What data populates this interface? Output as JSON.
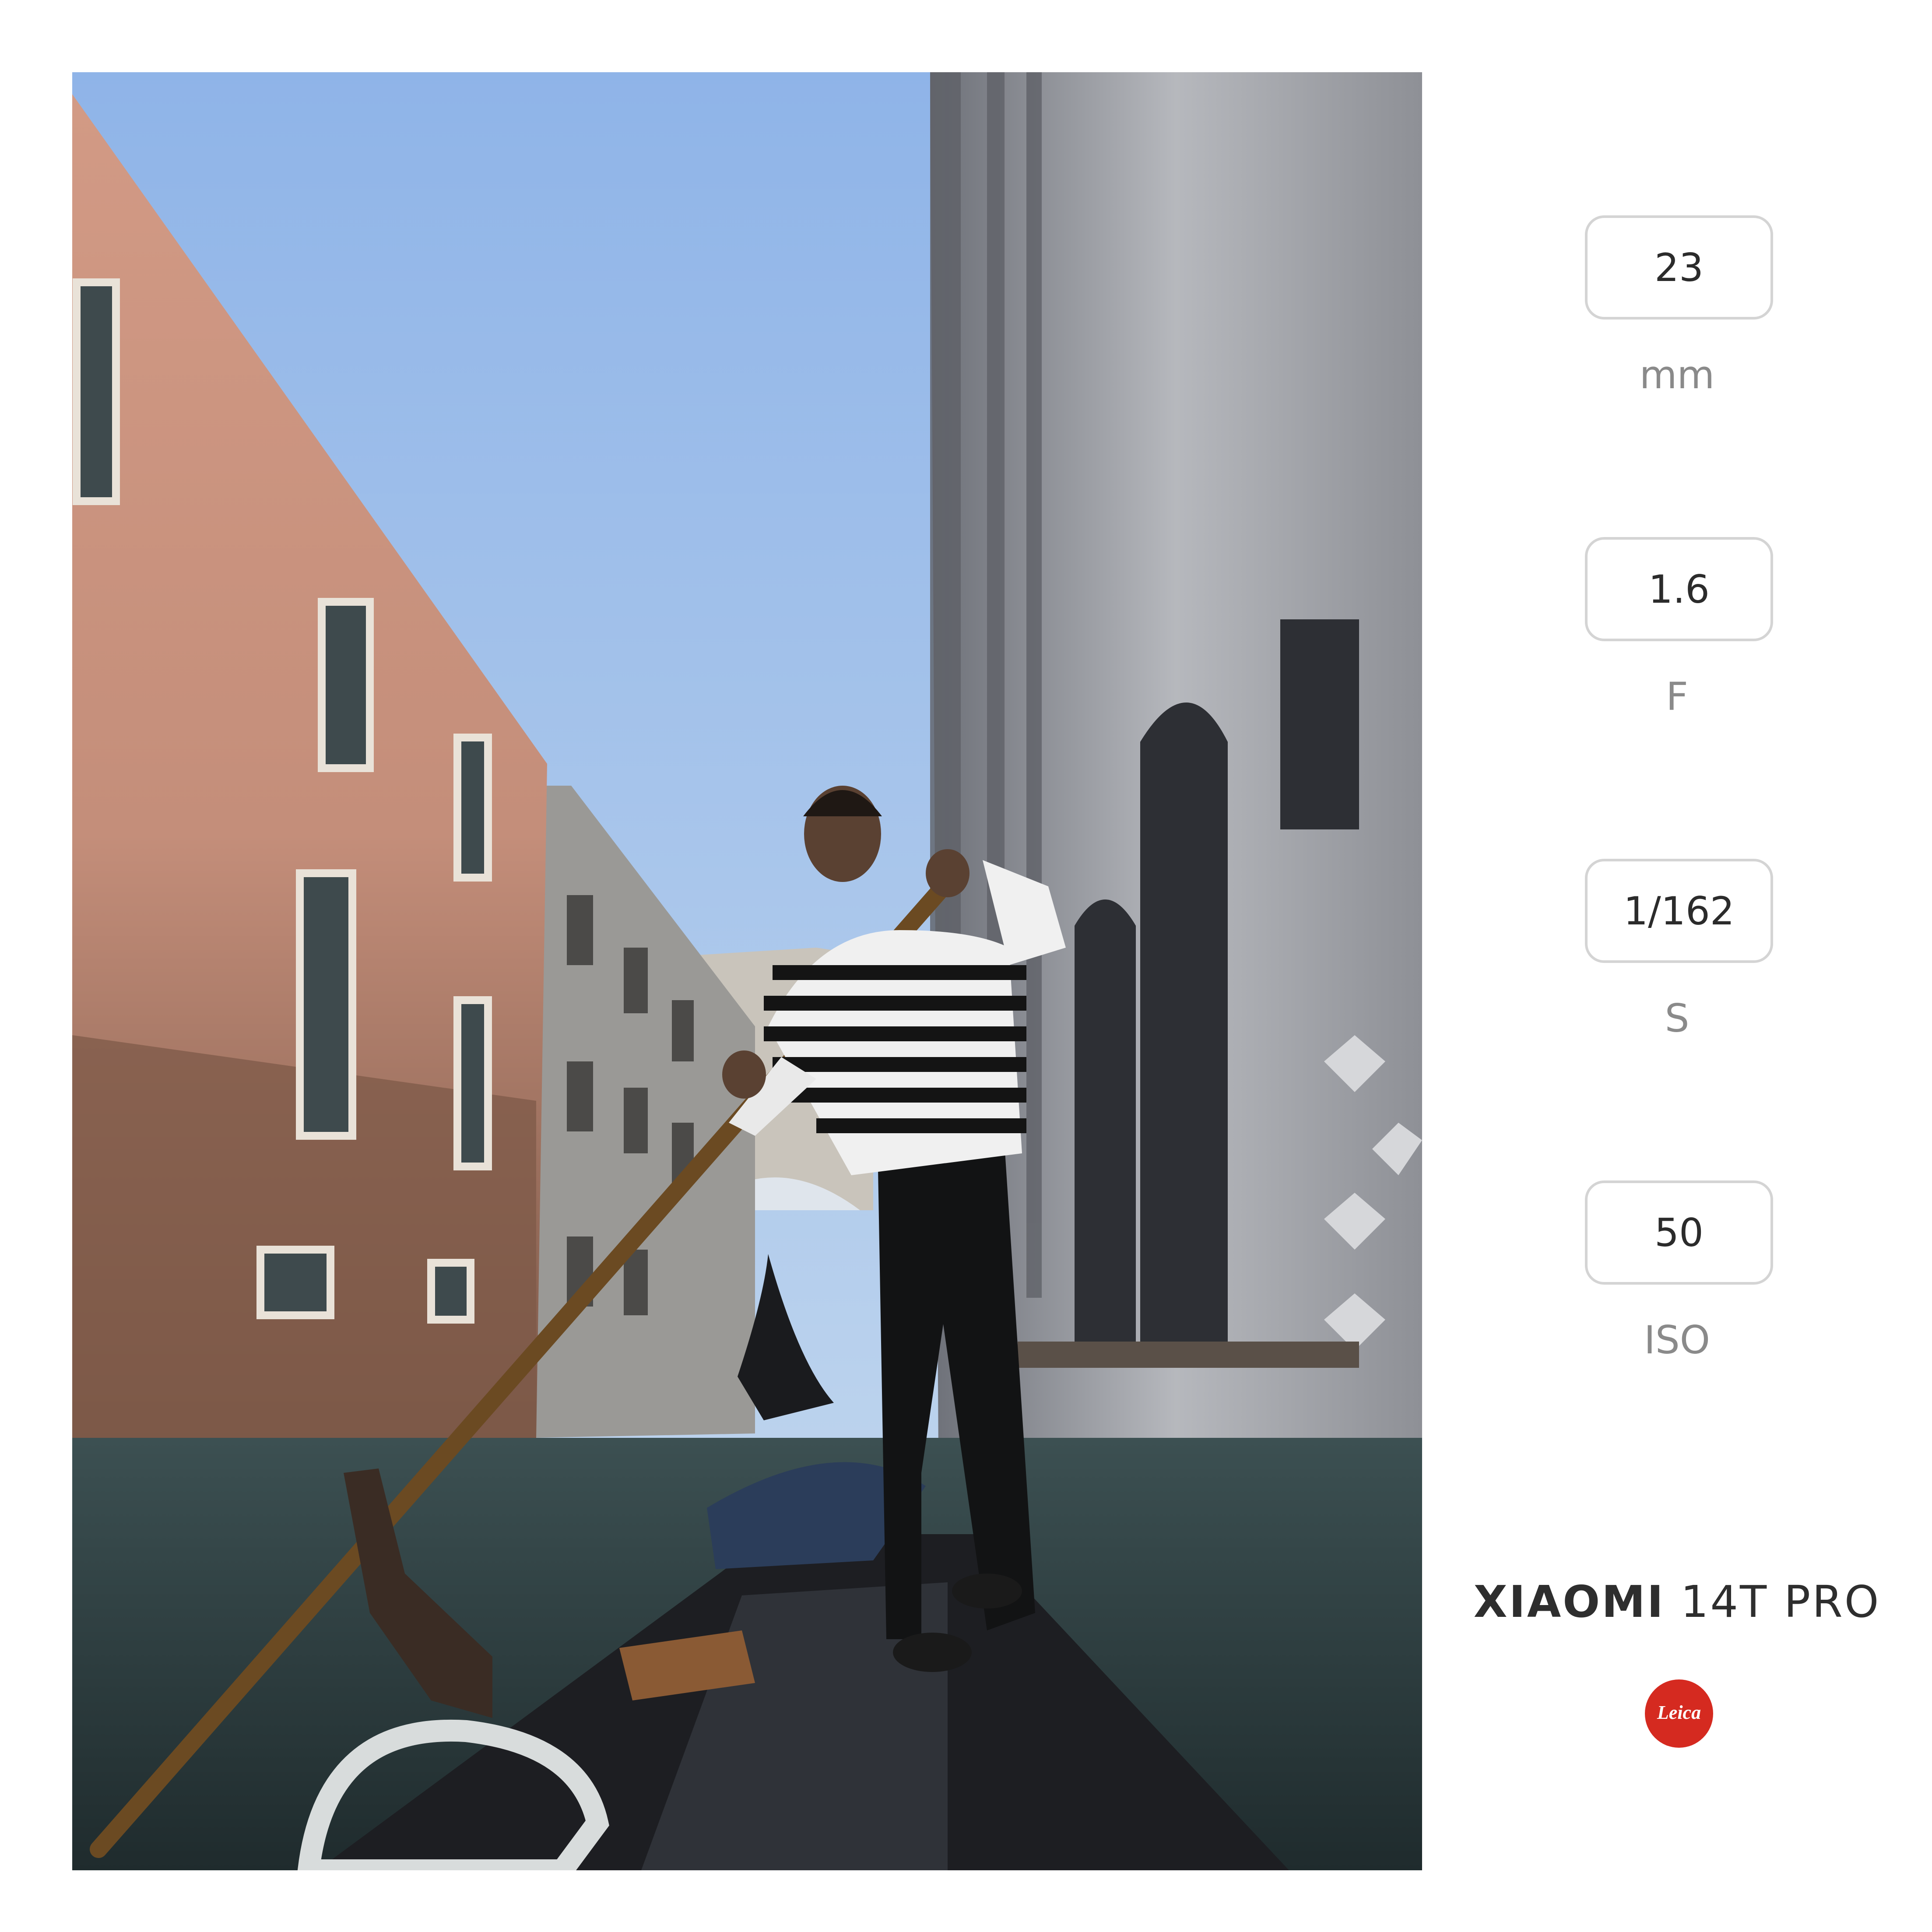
{
  "photo": {
    "subject": "gondolier",
    "scene": "venice-canal"
  },
  "exif": [
    {
      "value": "23",
      "unit": "mm"
    },
    {
      "value": "1.6",
      "unit": "F"
    },
    {
      "value": "1/162",
      "unit": "S"
    },
    {
      "value": "50",
      "unit": "ISO"
    }
  ],
  "branding": {
    "brand": "XIAOMI",
    "model": "14T PRO",
    "logo_text": "Leica",
    "logo_color": "#d52a20"
  },
  "colors": {
    "background": "#ffffff",
    "box_border": "#d4d4d4",
    "value_text": "#2b2b2b",
    "unit_text": "#8a8a8a"
  }
}
